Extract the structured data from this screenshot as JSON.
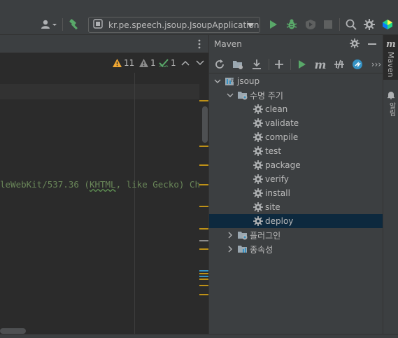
{
  "toolbar": {
    "run_config": "kr.pe.speech.jsoup.JsoupApplication",
    "icons": [
      "user-icon",
      "build-hammer-icon",
      "run-config-icon",
      "run-icon",
      "debug-icon",
      "coverage-icon",
      "stop-icon",
      "search-icon",
      "settings-icon",
      "toolbox-icon"
    ]
  },
  "editor": {
    "inspections": {
      "warnings": "11",
      "weak_warnings": "1",
      "typos": "1"
    },
    "code_line": {
      "before": "leWebKit/537.36 (",
      "underlined": "KHTML",
      "after": ", like Gecko) Ch"
    }
  },
  "maven": {
    "title": "Maven",
    "tree": {
      "project": "jsoup",
      "lifecycle_label": "수명 주기",
      "phases": [
        "clean",
        "validate",
        "compile",
        "test",
        "package",
        "verify",
        "install",
        "site",
        "deploy"
      ],
      "selected": "deploy",
      "plugins_label": "플러그인",
      "dependencies_label": "종속성"
    }
  },
  "stripe": {
    "maven_tab": "Maven",
    "notifications_tab": "알림"
  },
  "colors": {
    "background": "#2b2b2b",
    "panel": "#3c3f41",
    "selection": "#0d293e",
    "run_green": "#59a869",
    "warning": "#f0a732",
    "string_green": "#6a8759"
  }
}
